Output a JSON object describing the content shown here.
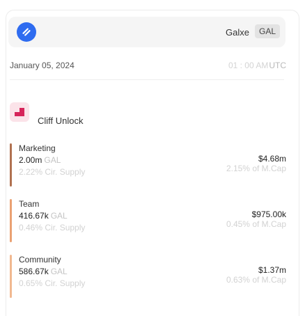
{
  "token": {
    "name": "Galxe",
    "symbol": "GAL",
    "logo_icon": "galxe-logo-icon",
    "logo_color": "#2f6cf0"
  },
  "event": {
    "date": "January 05, 2024",
    "time": "01 : 00 AM",
    "timezone": "UTC",
    "type_label": "Cliff Unlock",
    "type_icon": "cliff-unlock-icon",
    "type_color": "#d6245a"
  },
  "allocations": [
    {
      "name": "Marketing",
      "amount": "2.00m",
      "symbol": "GAL",
      "supply_pct": "2.22% Cir. Supply",
      "usd_value": "$4.68m",
      "mcap_pct": "2.15% of M.Cap",
      "color": "#b07150"
    },
    {
      "name": "Team",
      "amount": "416.67k",
      "symbol": "GAL",
      "supply_pct": "0.46% Cir. Supply",
      "usd_value": "$975.00k",
      "mcap_pct": "0.45% of M.Cap",
      "color": "#eaa172"
    },
    {
      "name": "Community",
      "amount": "586.67k",
      "symbol": "GAL",
      "supply_pct": "0.65% Cir. Supply",
      "usd_value": "$1.37m",
      "mcap_pct": "0.63% of M.Cap",
      "color": "#f1b890"
    }
  ]
}
